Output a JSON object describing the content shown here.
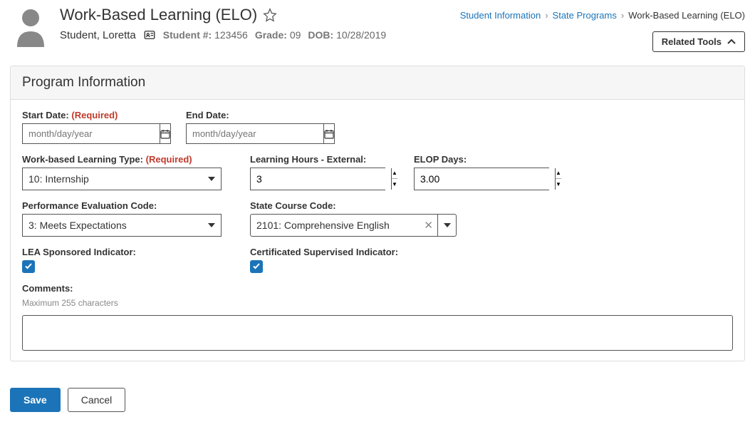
{
  "header": {
    "title": "Work-Based Learning (ELO)",
    "breadcrumb": {
      "link1": "Student Information",
      "link2": "State Programs",
      "current": "Work-Based Learning (ELO)"
    },
    "student": {
      "name": "Student, Loretta",
      "number_label": "Student #:",
      "number": "123456",
      "grade_label": "Grade:",
      "grade": "09",
      "dob_label": "DOB:",
      "dob": "10/28/2019"
    },
    "related_tools": "Related Tools"
  },
  "panel": {
    "title": "Program Information",
    "start_date": {
      "label": "Start Date:",
      "required": "(Required)",
      "placeholder": "month/day/year"
    },
    "end_date": {
      "label": "End Date:",
      "placeholder": "month/day/year"
    },
    "wbl_type": {
      "label": "Work-based Learning Type:",
      "required": "(Required)",
      "value": "10: Internship"
    },
    "hours_ext": {
      "label": "Learning Hours - External:",
      "value": "3"
    },
    "elop_days": {
      "label": "ELOP Days:",
      "value": "3.00"
    },
    "perf_code": {
      "label": "Performance Evaluation Code:",
      "value": "3: Meets Expectations"
    },
    "course_code": {
      "label": "State Course Code:",
      "value": "2101: Comprehensive English"
    },
    "lea": {
      "label": "LEA Sponsored Indicator:"
    },
    "cert": {
      "label": "Certificated Supervised Indicator:"
    },
    "comments": {
      "label": "Comments:",
      "hint": "Maximum 255 characters"
    }
  },
  "footer": {
    "save": "Save",
    "cancel": "Cancel"
  }
}
